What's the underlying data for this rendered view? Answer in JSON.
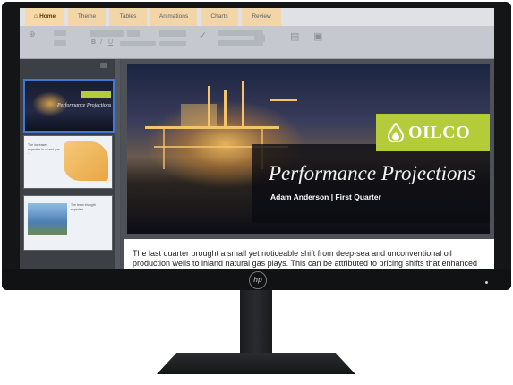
{
  "ribbon": {
    "tabs": [
      {
        "label": "Home",
        "icon": "home-icon",
        "active": true
      },
      {
        "label": "Theme"
      },
      {
        "label": "Tables"
      },
      {
        "label": "Animations"
      },
      {
        "label": "Charts"
      },
      {
        "label": "Review"
      }
    ]
  },
  "slide": {
    "logo_text": "OILCO",
    "title": "Performance Projections",
    "subtitle": "Adam Anderson   |   First Quarter",
    "accent_color": "#b5cc3a"
  },
  "thumbnails": [
    {
      "label": "Performance Projections"
    },
    {
      "label": "The increased expertise in oil and gas ..."
    },
    {
      "label": "The team brought expertise ..."
    }
  ],
  "notes": {
    "text": "The last quarter brought a small yet noticeable shift from deep-sea and unconventional oil production wells to inland natural gas plays. This can be attributed to pricing shifts that enhanced"
  },
  "device": {
    "brand_logo": "hp"
  }
}
